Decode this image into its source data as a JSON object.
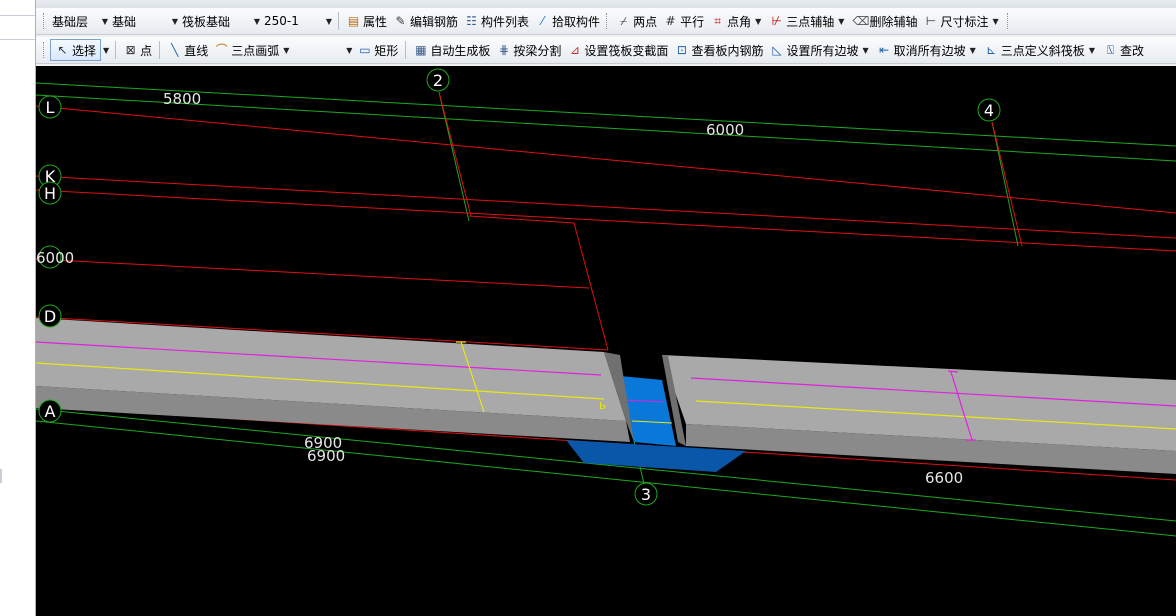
{
  "toolbar1": {
    "floor": "基础层",
    "category": "基础",
    "component_type": "筏板基础",
    "component": "250-1",
    "buttons": {
      "properties": "属性",
      "edit_rebar": "编辑钢筋",
      "component_list": "构件列表",
      "pick_component": "拾取构件",
      "two_points": "两点",
      "parallel": "平行",
      "point_angle": "点角",
      "three_point_aux": "三点辅轴",
      "delete_aux": "删除辅轴",
      "dimension": "尺寸标注"
    }
  },
  "toolbar2": {
    "buttons": {
      "select": "选择",
      "point": "点",
      "line": "直线",
      "arc": "三点画弧",
      "rect": "矩形",
      "auto_slab": "自动生成板",
      "split_by_beam": "按梁分割",
      "set_section": "设置筏板变截面",
      "view_rebar": "查看板内钢筋",
      "set_slopes": "设置所有边坡",
      "cancel_slopes": "取消所有边坡",
      "three_point_slope": "三点定义斜筏板",
      "check": "查改"
    }
  },
  "drawing": {
    "axis_numbers": [
      "2",
      "3",
      "4"
    ],
    "axis_letters": [
      "L",
      "K",
      "H",
      "D",
      "A"
    ],
    "dimensions": [
      "5800",
      "6000",
      "6000",
      "6900",
      "6900",
      "6600"
    ],
    "colors": {
      "background": "#000000",
      "grid_green": "#1fa81f",
      "axis_red": "#e01010",
      "beam_top": "#a9a9a9",
      "beam_front": "#888888",
      "beam_end": "#6e6e6e",
      "rebar_magenta": "#e020e0",
      "rebar_yellow": "#e8e814",
      "pit_blue": "#0a78d8",
      "pit_dark": "#0a56a8"
    }
  }
}
